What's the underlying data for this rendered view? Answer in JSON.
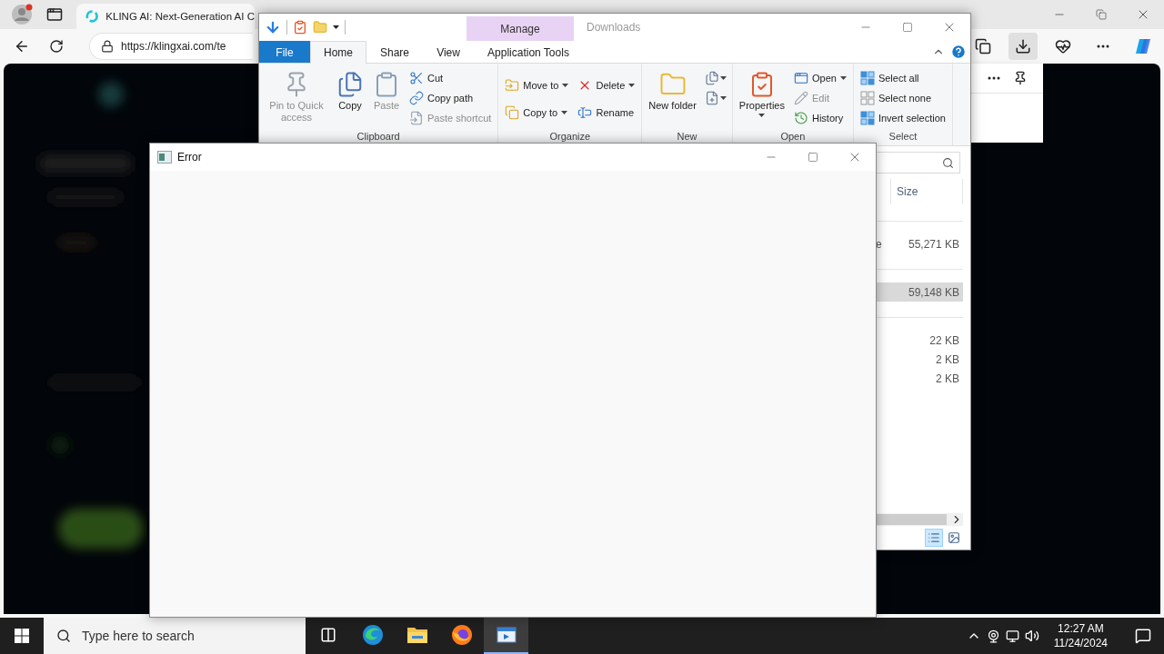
{
  "browser": {
    "tab": {
      "title": "KLING AI: Next-Generation AI C",
      "selected": true
    },
    "url": "https://klingxai.com/te",
    "downloads_active": true
  },
  "explorer": {
    "title": "Downloads",
    "contextual_header": "Manage",
    "tabs": [
      {
        "label": "File",
        "kind": "file",
        "selected": false
      },
      {
        "label": "Home",
        "kind": "normal",
        "selected": true
      },
      {
        "label": "Share",
        "kind": "normal",
        "selected": false
      },
      {
        "label": "View",
        "kind": "normal",
        "selected": false
      },
      {
        "label": "Application Tools",
        "kind": "contextual",
        "selected": false
      }
    ],
    "groups": [
      {
        "label": "Clipboard",
        "items": [
          {
            "kind": "large",
            "label": "Pin to Quick access",
            "disabled": true,
            "dropdown": false
          },
          {
            "kind": "large",
            "label": "Copy",
            "disabled": false,
            "dropdown": false
          },
          {
            "kind": "large",
            "label": "Paste",
            "disabled": true,
            "dropdown": false
          },
          {
            "kind": "stack",
            "items": [
              {
                "label": "Cut",
                "disabled": false,
                "dropdown": false
              },
              {
                "label": "Copy path",
                "disabled": false,
                "dropdown": false
              },
              {
                "label": "Paste shortcut",
                "disabled": true,
                "dropdown": false
              }
            ]
          }
        ]
      },
      {
        "label": "Organize",
        "items": [
          {
            "kind": "stack",
            "items": [
              {
                "label": "Move to",
                "disabled": false,
                "dropdown": true
              },
              {
                "label": "Copy to",
                "disabled": false,
                "dropdown": true
              }
            ]
          },
          {
            "kind": "stack",
            "items": [
              {
                "label": "Delete",
                "disabled": false,
                "dropdown": true
              },
              {
                "label": "Rename",
                "disabled": false,
                "dropdown": false
              }
            ]
          }
        ]
      },
      {
        "label": "New",
        "items": [
          {
            "kind": "large",
            "label": "New folder",
            "disabled": false,
            "dropdown": false
          },
          {
            "kind": "icons",
            "items": [
              {
                "disabled": false,
                "dropdown": true
              },
              {
                "disabled": false,
                "dropdown": true
              }
            ]
          }
        ]
      },
      {
        "label": "Open",
        "items": [
          {
            "kind": "large",
            "label": "Properties",
            "disabled": false,
            "dropdown": true
          },
          {
            "kind": "stack",
            "items": [
              {
                "label": "Open",
                "disabled": false,
                "dropdown": true
              },
              {
                "label": "Edit",
                "disabled": true,
                "dropdown": false
              },
              {
                "label": "History",
                "disabled": false,
                "dropdown": false
              }
            ]
          }
        ]
      },
      {
        "label": "Select",
        "items": [
          {
            "kind": "stack",
            "items": [
              {
                "label": "Select all",
                "disabled": false,
                "dropdown": false
              },
              {
                "label": "Select none",
                "disabled": false,
                "dropdown": false
              },
              {
                "label": "Invert selection",
                "disabled": false,
                "dropdown": false
              }
            ]
          }
        ]
      }
    ],
    "columns": [
      {
        "label": "Size"
      }
    ],
    "file_groups": [
      {
        "rows": [
          {
            "type": "e",
            "size": "55,271 KB",
            "selected": false
          }
        ]
      },
      {
        "rows": [
          {
            "size": "59,148 KB",
            "selected": true
          }
        ]
      },
      {
        "rows": [
          {
            "size": "22 KB",
            "selected": false
          },
          {
            "size": "2 KB",
            "selected": false
          },
          {
            "size": "2 KB",
            "selected": false
          }
        ]
      }
    ],
    "views": [
      {
        "kind": "details",
        "selected": true
      },
      {
        "kind": "large-icons",
        "selected": false
      }
    ]
  },
  "error_window": {
    "title": "Error"
  },
  "taskbar": {
    "search_placeholder": "Type here to search",
    "apps": [
      {
        "kind": "task-view",
        "selected": false
      },
      {
        "kind": "edge",
        "selected": false
      },
      {
        "kind": "explorer",
        "selected": false
      },
      {
        "kind": "firefox",
        "selected": false
      },
      {
        "kind": "app-window",
        "selected": true
      }
    ],
    "time": "12:27 AM",
    "date": "11/24/2024"
  }
}
